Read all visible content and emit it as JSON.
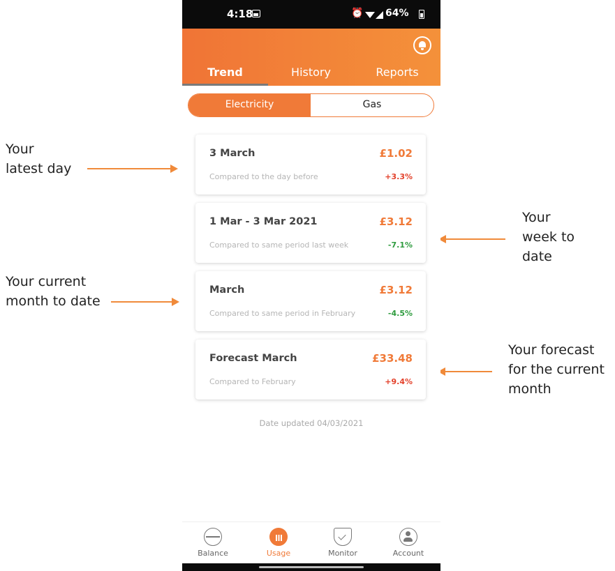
{
  "annotations": {
    "latest_day": [
      "Your",
      "latest day"
    ],
    "week_to_date": [
      "Your",
      "week to",
      "date"
    ],
    "month_to_date": [
      "Your current",
      "month to date"
    ],
    "forecast": [
      "Your forecast",
      "for the current",
      "month"
    ]
  },
  "status_bar": {
    "time": "4:18",
    "battery": "64%",
    "icons": [
      "image-icon",
      "alarm-icon",
      "wifi-icon",
      "signal-icon",
      "battery-icon"
    ]
  },
  "header": {
    "tabs": [
      {
        "label": "Trend",
        "active": true
      },
      {
        "label": "History",
        "active": false
      },
      {
        "label": "Reports",
        "active": false
      }
    ]
  },
  "fuel_toggle": {
    "options": [
      "Electricity",
      "Gas"
    ],
    "selected": "Electricity"
  },
  "cards": [
    {
      "title": "3 March",
      "amount": "£1.02",
      "comparison": "Compared to the day before",
      "change": "+3.3%",
      "direction": "up"
    },
    {
      "title": "1 Mar - 3 Mar 2021",
      "amount": "£3.12",
      "comparison": "Compared to same period last week",
      "change": "-7.1%",
      "direction": "down"
    },
    {
      "title": "March",
      "amount": "£3.12",
      "comparison": "Compared to same period in February",
      "change": "-4.5%",
      "direction": "down"
    },
    {
      "title": "Forecast March",
      "amount": "£33.48",
      "comparison": "Compared to February",
      "change": "+9.4%",
      "direction": "up"
    }
  ],
  "date_updated": "Date updated 04/03/2021",
  "bottom_nav": [
    {
      "label": "Balance",
      "icon": "balance-icon",
      "active": false
    },
    {
      "label": "Usage",
      "icon": "usage-icon",
      "active": true
    },
    {
      "label": "Monitor",
      "icon": "monitor-icon",
      "active": false
    },
    {
      "label": "Account",
      "icon": "account-icon",
      "active": false
    }
  ],
  "colors": {
    "accent": "#f07a38",
    "increase": "#e3412b",
    "decrease": "#2e9b3e"
  }
}
